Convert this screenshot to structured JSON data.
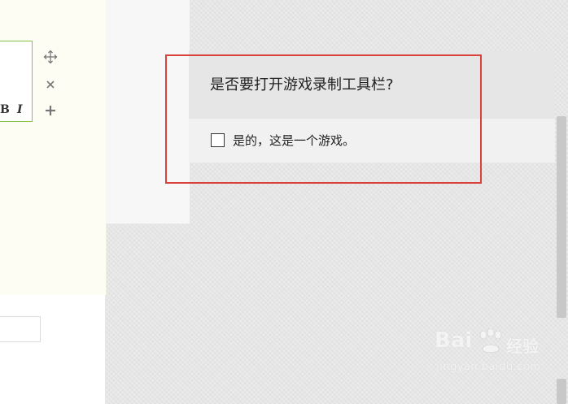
{
  "dialog": {
    "title": "是否要打开游戏录制工具栏?",
    "checkbox_label": "是的，这是一个游戏。",
    "checkbox_checked": false
  },
  "editor": {
    "bold_label": "B",
    "italic_label": "I",
    "icons": {
      "move": "move-icon",
      "close": "close-icon",
      "add": "plus-icon"
    }
  },
  "watermark": {
    "brand": "Bai",
    "suffix": "经验",
    "url": "jingyan.baidu.com"
  },
  "colors": {
    "highlight": "#d9413b",
    "editor_border": "#8bc34a",
    "dialog_header": "#e6e6e6",
    "dialog_body": "#f1f1f1"
  }
}
